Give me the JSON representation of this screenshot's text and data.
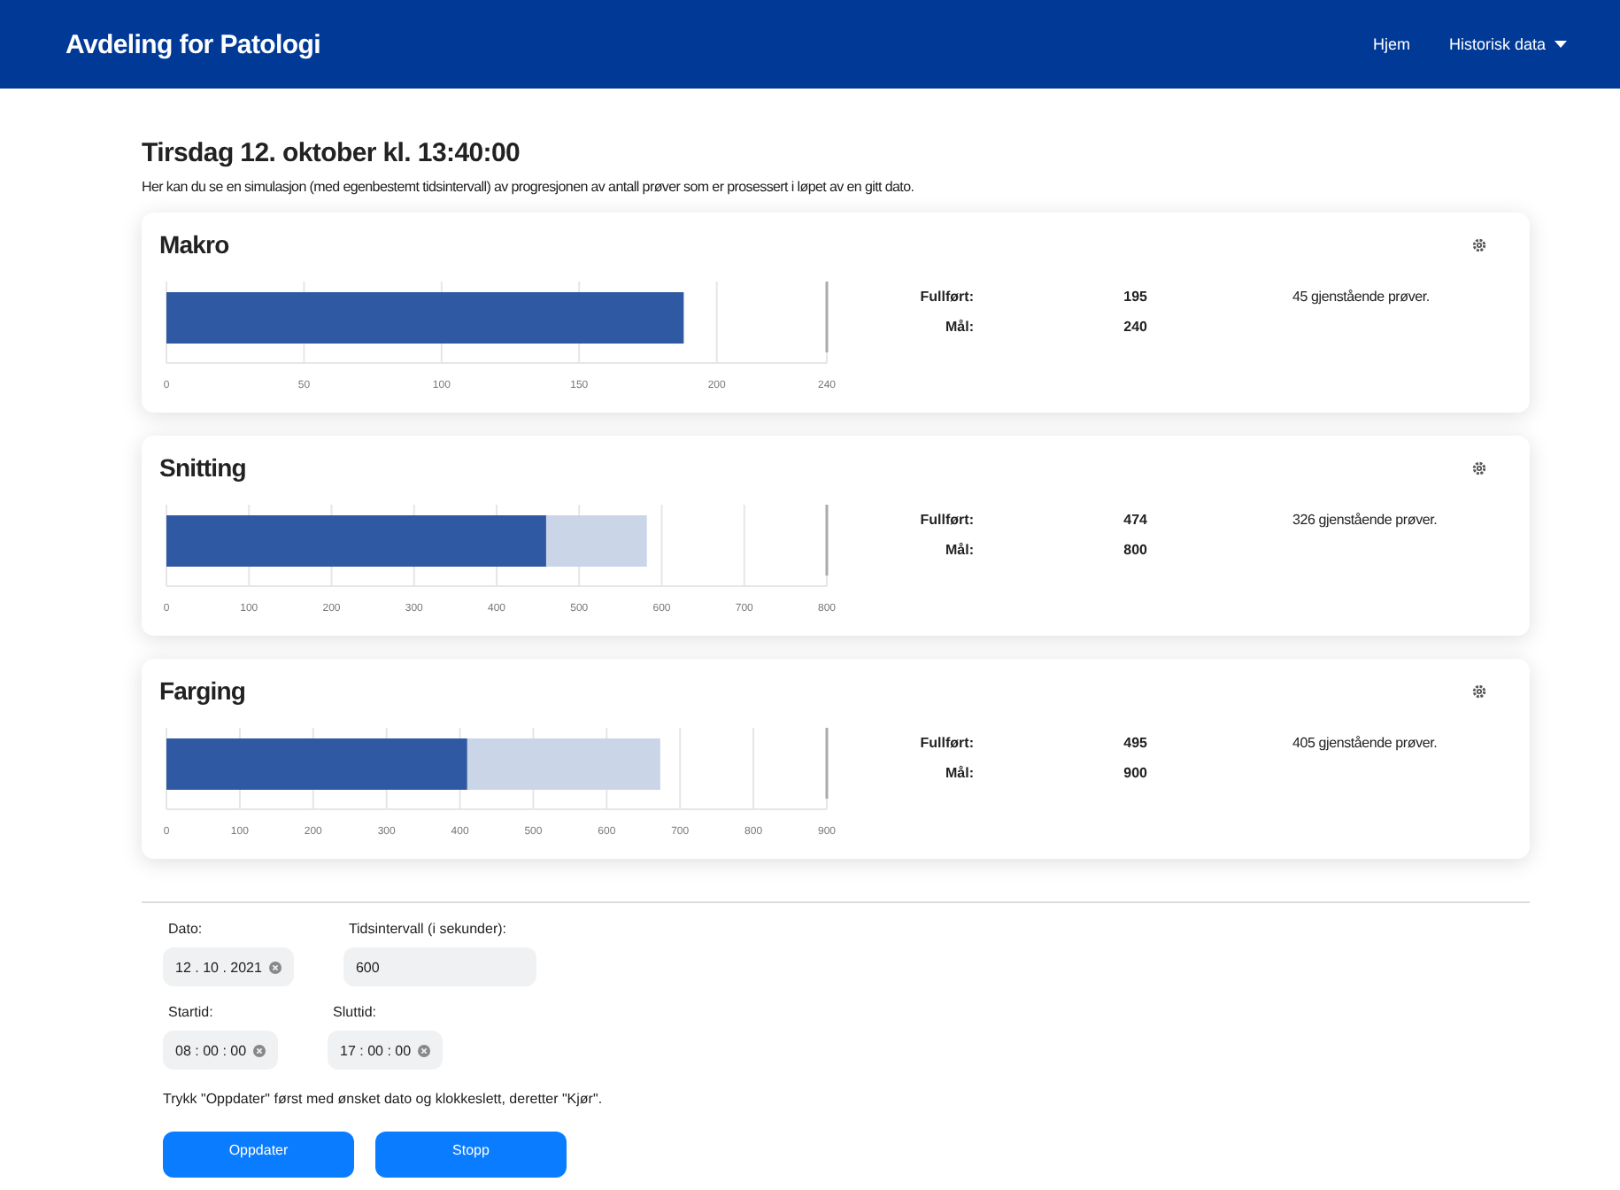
{
  "navbar": {
    "brand": "Avdeling for Patologi",
    "links": [
      {
        "label": "Hjem",
        "kind": "link"
      },
      {
        "label": "Historisk data",
        "kind": "dropdown"
      }
    ]
  },
  "heading": "Tirsdag 12. oktober kl. 13:40:00",
  "intro": "Her kan du se en simulasjon (med egenbestemt tidsintervall) av progresjonen av antall prøver som er prosessert i løpet av en gitt dato.",
  "panels": [
    {
      "title": "Makro",
      "chart_data": {
        "type": "bar",
        "orientation": "horizontal",
        "stacked": true,
        "grid": true,
        "xlim": [
          0,
          240
        ],
        "xticks": [
          0,
          50,
          100,
          150,
          200,
          240
        ],
        "series": [
          {
            "color": "#3059a3",
            "values": [
              188
            ]
          }
        ]
      },
      "stats": [
        {
          "label": "Fullført:",
          "value": "195"
        },
        {
          "label": "Mål:",
          "value": "240"
        }
      ],
      "remaining": "45 gjenstående prøver."
    },
    {
      "title": "Snitting",
      "chart_data": {
        "type": "bar",
        "orientation": "horizontal",
        "stacked": true,
        "grid": true,
        "xlim": [
          0,
          800
        ],
        "xticks": [
          0,
          100,
          200,
          300,
          400,
          500,
          600,
          700,
          800
        ],
        "series": [
          {
            "color": "#3059a3",
            "values": [
              460
            ]
          },
          {
            "color": "#cbd5e8",
            "values": [
              122
            ]
          }
        ]
      },
      "stats": [
        {
          "label": "Fullført:",
          "value": "474"
        },
        {
          "label": "Mål:",
          "value": "800"
        }
      ],
      "remaining": "326 gjenstående prøver."
    },
    {
      "title": "Farging",
      "chart_data": {
        "type": "bar",
        "orientation": "horizontal",
        "stacked": true,
        "grid": true,
        "xlim": [
          0,
          900
        ],
        "xticks": [
          0,
          100,
          200,
          300,
          400,
          500,
          600,
          700,
          800,
          900
        ],
        "series": [
          {
            "color": "#3059a3",
            "values": [
              410
            ]
          },
          {
            "color": "#cbd5e8",
            "values": [
              263
            ]
          }
        ]
      },
      "stats": [
        {
          "label": "Fullført:",
          "value": "495"
        },
        {
          "label": "Mål:",
          "value": "900"
        }
      ],
      "remaining": "405 gjenstående prøver."
    }
  ],
  "form": {
    "rows": [
      [
        {
          "label": "Dato:",
          "value": "12 . 10 . 2021",
          "kind": "date"
        },
        {
          "label": "Tidsintervall (i sekunder):",
          "value": "600",
          "kind": "number"
        }
      ],
      [
        {
          "label": "Startid:",
          "value": "08 : 00 : 00",
          "kind": "time"
        },
        {
          "label": "Sluttid:",
          "value": "17 : 00 : 00",
          "kind": "time"
        }
      ]
    ],
    "hint": "Trykk \"Oppdater\" først med ønsket dato og klokkeslett, deretter \"Kjør\".",
    "buttons": [
      "Oppdater",
      "Stopp"
    ]
  }
}
